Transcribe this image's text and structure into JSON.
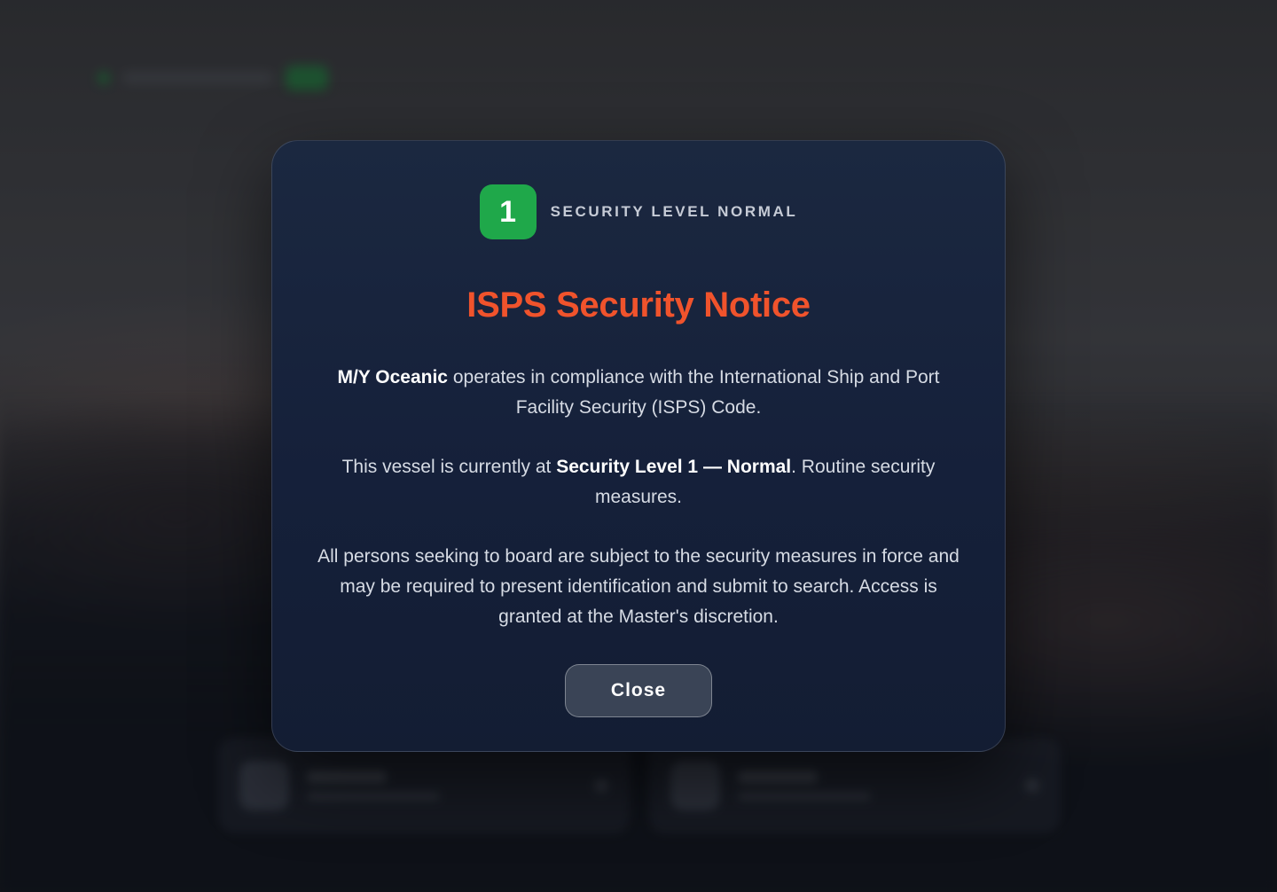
{
  "badge": {
    "number": "1",
    "label": "SECURITY LEVEL NORMAL"
  },
  "modal": {
    "title": "ISPS Security Notice",
    "paragraph1": {
      "vessel_name": "M/Y Oceanic",
      "text": " operates in compliance with the International Ship and Port Facility Security (ISPS) Code."
    },
    "paragraph2": {
      "prefix": "This vessel is currently at ",
      "level_text": "Security Level 1 — Normal",
      "suffix": ". Routine security measures."
    },
    "paragraph3": "All persons seeking to board are subject to the security measures in force and may be required to present identification and submit to search. Access is granted at the Master's discretion.",
    "close_label": "Close"
  },
  "colors": {
    "accent": "#f0532c",
    "badge_green": "#1fa84a"
  }
}
